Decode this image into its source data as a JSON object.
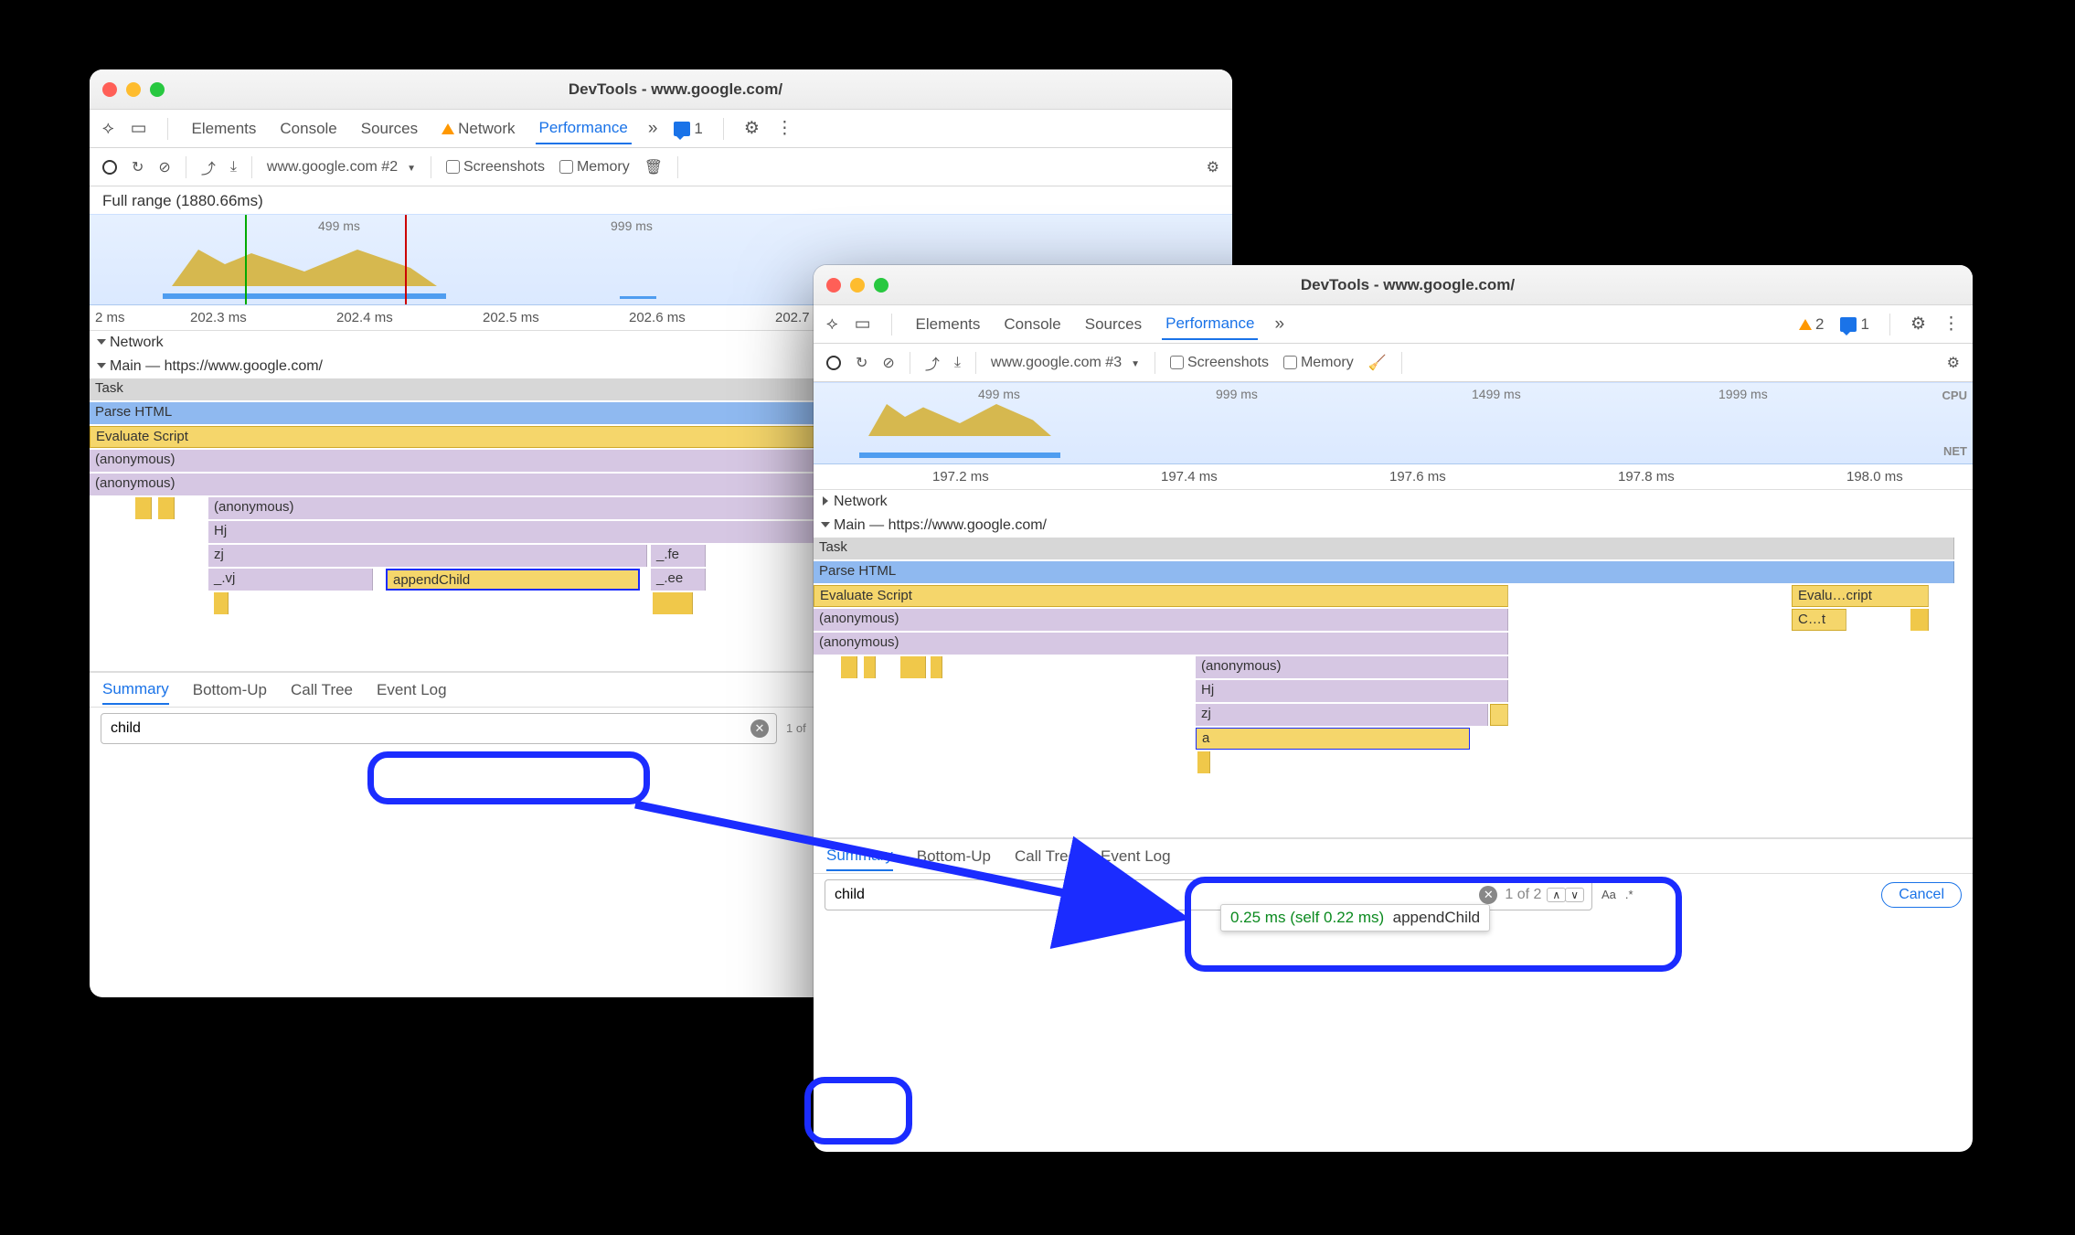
{
  "win1": {
    "title": "DevTools - www.google.com/",
    "tabs": {
      "elements": "Elements",
      "console": "Console",
      "sources": "Sources",
      "network": "Network",
      "performance": "Performance"
    },
    "msg_count": "1",
    "toolbar": {
      "recording_label": "www.google.com #2",
      "screenshots": "Screenshots",
      "memory": "Memory"
    },
    "fullrange": "Full range (1880.66ms)",
    "overview_ticks": {
      "t1": "499 ms",
      "t2": "999 ms"
    },
    "ruler_ticks": {
      "t0": "2 ms",
      "t1": "202.3 ms",
      "t2": "202.4 ms",
      "t3": "202.5 ms",
      "t4": "202.6 ms",
      "t5": "202.7"
    },
    "sections": {
      "network": "Network",
      "main": "Main — https://www.google.com/"
    },
    "flame": {
      "task": "Task",
      "parse": "Parse HTML",
      "eval": "Evaluate Script",
      "anon": "(anonymous)",
      "hj": "Hj",
      "zj": "zj",
      "vj": "_.vj",
      "append": "appendChild",
      "fe": "_.fe",
      "ee": "_.ee"
    },
    "btabs": {
      "summary": "Summary",
      "bottomup": "Bottom-Up",
      "calltree": "Call Tree",
      "eventlog": "Event Log"
    },
    "search": {
      "value": "child",
      "matches": "1 of"
    }
  },
  "win2": {
    "title": "DevTools - www.google.com/",
    "tabs": {
      "elements": "Elements",
      "console": "Console",
      "sources": "Sources",
      "performance": "Performance"
    },
    "warn_count": "2",
    "msg_count": "1",
    "toolbar": {
      "recording_label": "www.google.com #3",
      "screenshots": "Screenshots",
      "memory": "Memory"
    },
    "overview_ticks": {
      "t1": "499 ms",
      "t2": "999 ms",
      "t3": "1499 ms",
      "t4": "1999 ms"
    },
    "overview_labels": {
      "cpu": "CPU",
      "net": "NET"
    },
    "ruler_ticks": {
      "t1": "197.2 ms",
      "t2": "197.4 ms",
      "t3": "197.6 ms",
      "t4": "197.8 ms",
      "t5": "198.0 ms"
    },
    "sections": {
      "network": "Network",
      "main": "Main — https://www.google.com/"
    },
    "flame": {
      "task": "Task",
      "parse": "Parse HTML",
      "eval": "Evaluate Script",
      "eval2": "Evalu…cript",
      "ct": "C…t",
      "anon": "(anonymous)",
      "hj": "Hj",
      "zj": "zj",
      "a": "a"
    },
    "tooltip": {
      "time": "0.25 ms (self 0.22 ms)",
      "name": "appendChild"
    },
    "btabs": {
      "summary": "Summary",
      "bottomup": "Bottom-Up",
      "calltree": "Call Tree",
      "eventlog": "Event Log"
    },
    "search": {
      "value": "child",
      "matches": "1 of 2",
      "aa": "Aa",
      "regex": ".*",
      "cancel": "Cancel"
    }
  }
}
